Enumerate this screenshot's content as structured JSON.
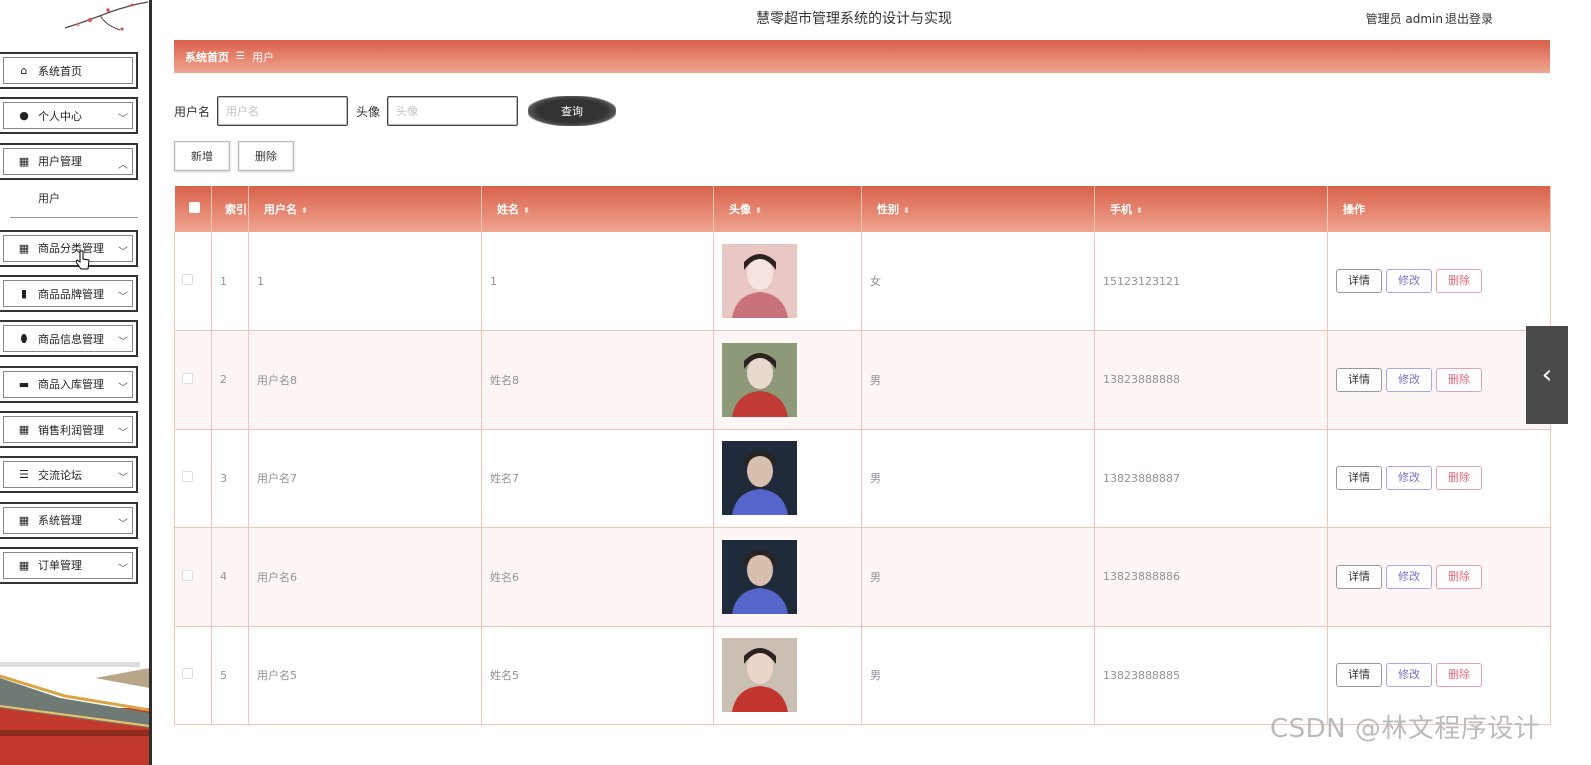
{
  "app": {
    "title": "慧零超市管理系统的设计与实现",
    "admin_label": "管理员 admin",
    "logout": "退出登录"
  },
  "sidebar": {
    "items": [
      {
        "label": "系统首页",
        "icon": "home-icon",
        "chevron": ""
      },
      {
        "label": "个人中心",
        "icon": "user-icon",
        "chevron": "﹀"
      },
      {
        "label": "用户管理",
        "icon": "grid-icon",
        "chevron": "︿"
      },
      {
        "label": "商品分类管理",
        "icon": "grid-icon",
        "chevron": "﹀"
      },
      {
        "label": "商品品牌管理",
        "icon": "bar-chart-icon",
        "chevron": "﹀"
      },
      {
        "label": "商品信息管理",
        "icon": "pin-icon",
        "chevron": "﹀"
      },
      {
        "label": "商品入库管理",
        "icon": "chat-icon",
        "chevron": "﹀"
      },
      {
        "label": "销售利润管理",
        "icon": "grid-icon",
        "chevron": "﹀"
      },
      {
        "label": "交流论坛",
        "icon": "list-icon",
        "chevron": "﹀"
      },
      {
        "label": "系统管理",
        "icon": "grid-icon",
        "chevron": "﹀"
      },
      {
        "label": "订单管理",
        "icon": "grid-icon",
        "chevron": "﹀"
      }
    ],
    "sub_item": "用户"
  },
  "breadcrumb": {
    "home": "系统首页",
    "separator": "☰",
    "current": "用户"
  },
  "search": {
    "username_label": "用户名",
    "username_placeholder": "用户名",
    "avatar_label": "头像",
    "avatar_placeholder": "头像",
    "query_button": "查询"
  },
  "actions": {
    "add": "新增",
    "delete": "删除"
  },
  "table": {
    "headers": [
      "索引",
      "用户名",
      "姓名",
      "头像",
      "性别",
      "手机",
      "操作"
    ],
    "rows": [
      {
        "index": "1",
        "username": "1",
        "name": "1",
        "gender": "女",
        "phone": "15123123121",
        "avatar_colors": [
          "#e8c7c4",
          "#c9727a",
          "#f4e3df"
        ]
      },
      {
        "index": "2",
        "username": "用户名8",
        "name": "姓名8",
        "gender": "男",
        "phone": "13823888888",
        "avatar_colors": [
          "#8d9a7a",
          "#c23a36",
          "#e8d9cf"
        ]
      },
      {
        "index": "3",
        "username": "用户名7",
        "name": "姓名7",
        "gender": "男",
        "phone": "13823888887",
        "avatar_colors": [
          "#1f2a3a",
          "#5665c9",
          "#d9bfae"
        ]
      },
      {
        "index": "4",
        "username": "用户名6",
        "name": "姓名6",
        "gender": "男",
        "phone": "13823888886",
        "avatar_colors": [
          "#1f2a3a",
          "#5665c9",
          "#d9bfae"
        ]
      },
      {
        "index": "5",
        "username": "用户名5",
        "name": "姓名5",
        "gender": "男",
        "phone": "13823888885",
        "avatar_colors": [
          "#c9c0b3",
          "#c2362f",
          "#ead6c8"
        ]
      }
    ],
    "row_actions": {
      "detail": "详情",
      "edit": "修改",
      "delete": "删除"
    }
  },
  "watermark": "CSDN @林文程序设计",
  "colors": {
    "accent_start": "#d9614a",
    "accent_end": "#f0a591",
    "dark": "#2e2e2e"
  }
}
